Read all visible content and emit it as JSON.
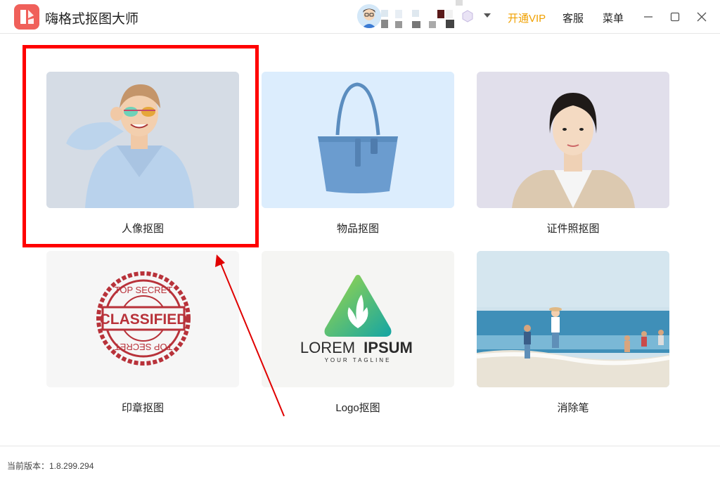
{
  "app": {
    "title": "嗨格式抠图大师"
  },
  "header": {
    "vip_label": "开通VIP",
    "service_label": "客服",
    "menu_label": "菜单"
  },
  "cards": [
    {
      "label": "人像抠图"
    },
    {
      "label": "物品抠图"
    },
    {
      "label": "证件照抠图"
    },
    {
      "label": "印章抠图"
    },
    {
      "label": "Logo抠图"
    },
    {
      "label": "消除笔"
    }
  ],
  "stamp": {
    "top_text": "TOP SECRET",
    "center_text": "CLASSIFIED",
    "bottom_text": "TOP SECRET"
  },
  "logo_sample": {
    "word1": "LOREM",
    "word2": "IPSUM",
    "tagline": "YOUR TAGLINE"
  },
  "footer": {
    "version_label": "当前版本：1.8.299.294"
  },
  "colors": {
    "accent_vip": "#f0a000",
    "highlight": "#ff0000",
    "app_logo": "#f0605a"
  },
  "icons": {
    "minimize": "minimize-icon",
    "maximize": "maximize-icon",
    "close": "close-icon",
    "dropdown": "chevron-down-icon"
  }
}
